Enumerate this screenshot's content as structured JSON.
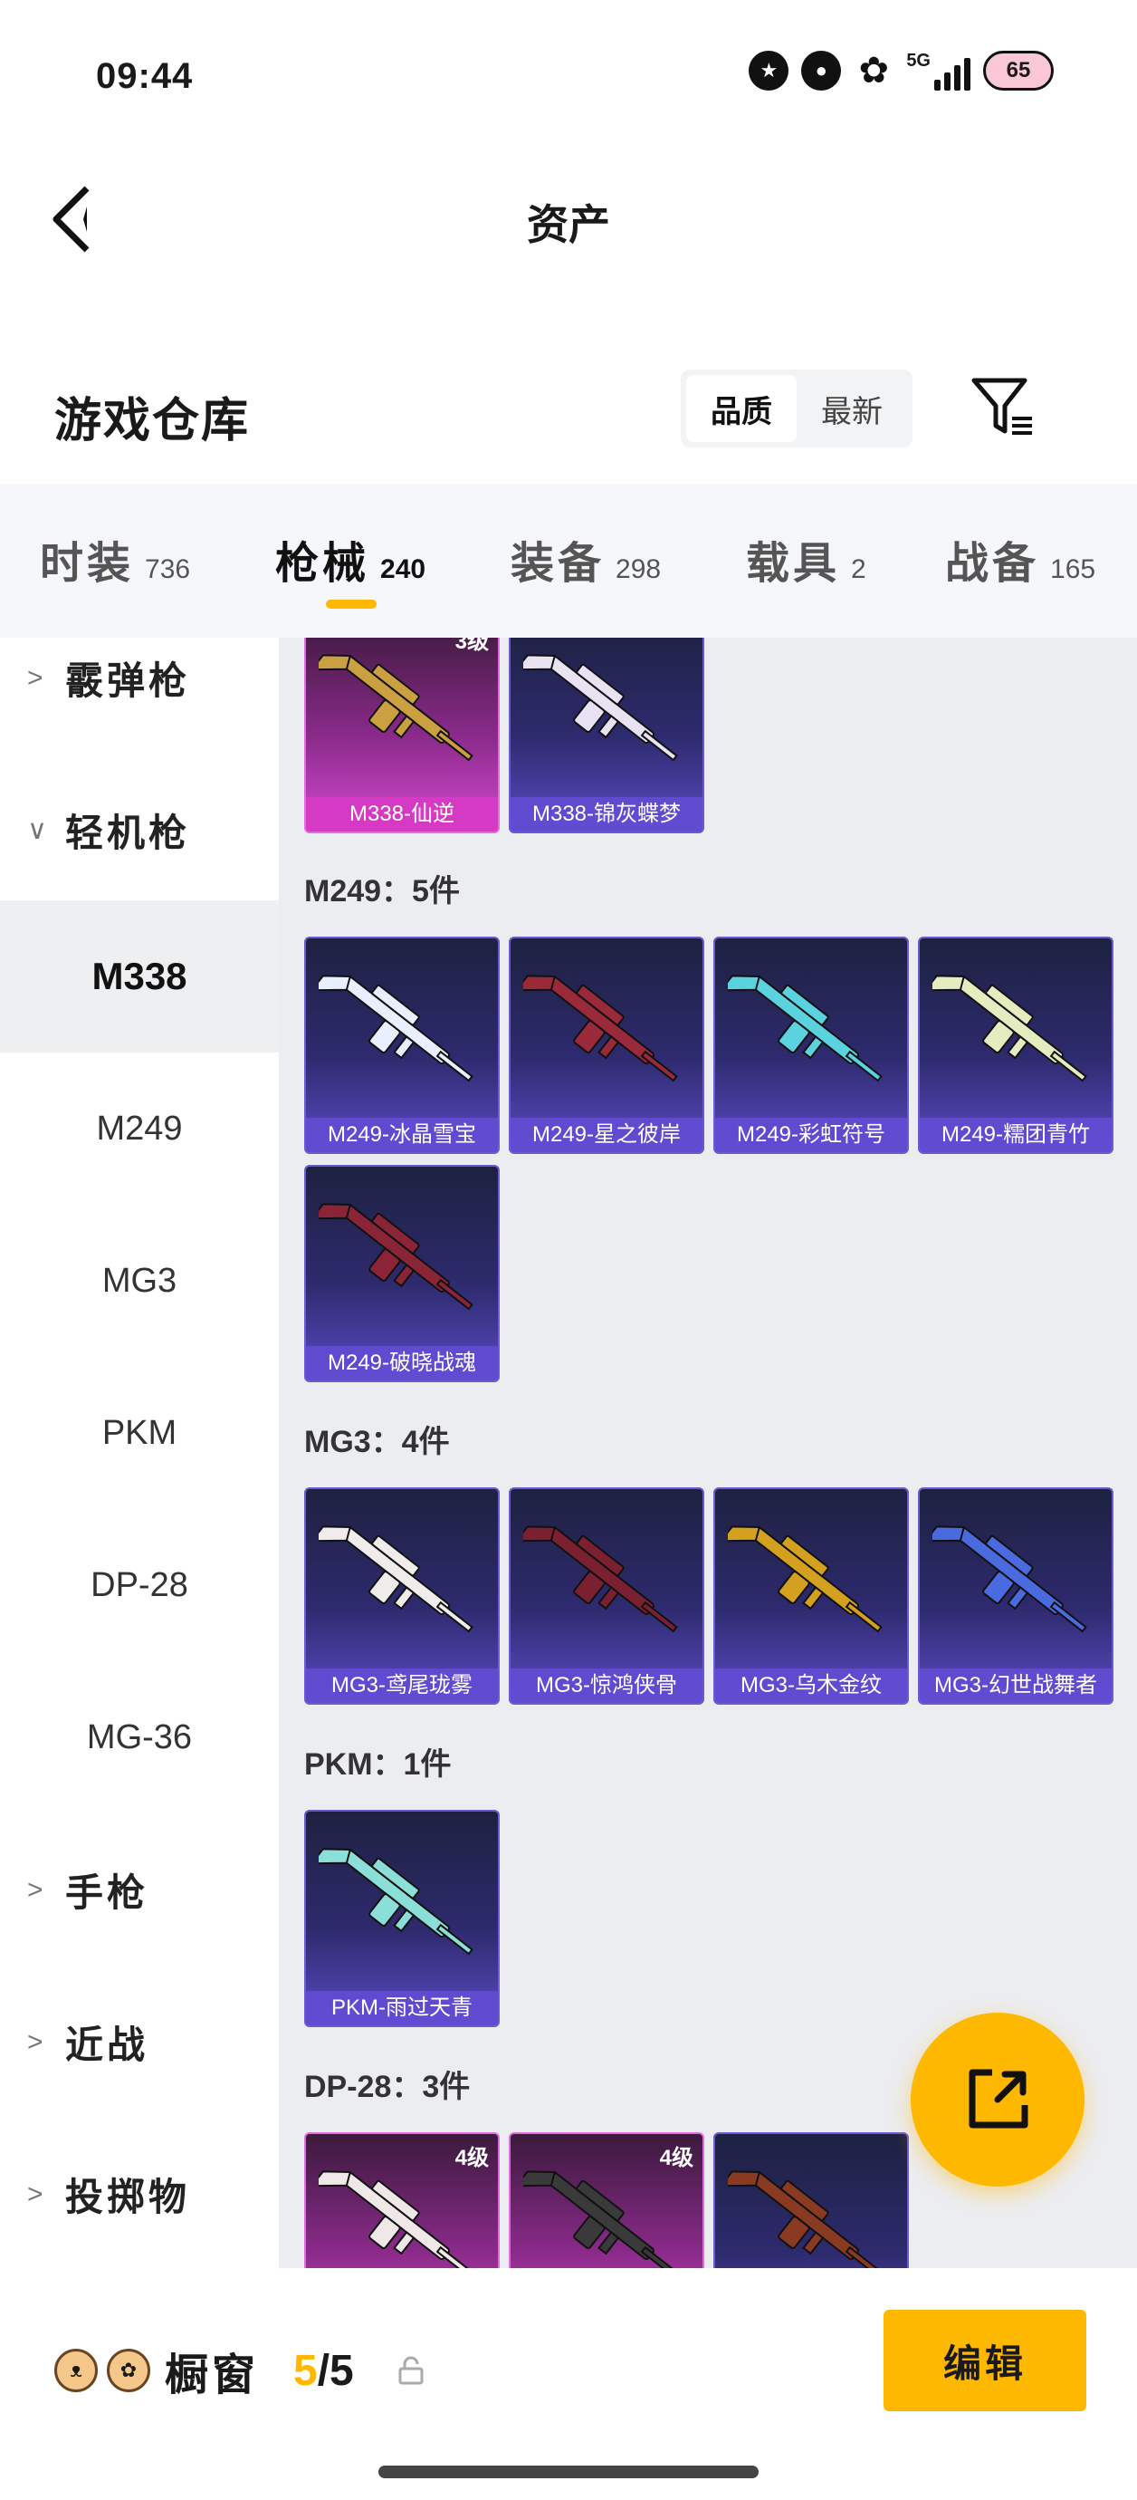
{
  "status": {
    "time": "09:44",
    "network": "5G",
    "battery": "65"
  },
  "header": {
    "title": "资产"
  },
  "section": {
    "title": "游戏仓库",
    "sort_options": [
      "品质",
      "最新"
    ],
    "sort_selected": "品质"
  },
  "tabs": [
    {
      "label": "时装",
      "count": "736"
    },
    {
      "label": "枪械",
      "count": "240"
    },
    {
      "label": "装备",
      "count": "298"
    },
    {
      "label": "载具",
      "count": "2"
    },
    {
      "label": "战备",
      "count": "165"
    }
  ],
  "active_tab": "枪械",
  "sidebar": {
    "groups": [
      {
        "label": "霰弹枪",
        "expanded": false
      },
      {
        "label": "轻机枪",
        "expanded": true
      },
      {
        "label": "手枪",
        "expanded": false
      },
      {
        "label": "近战",
        "expanded": false
      },
      {
        "label": "投掷物",
        "expanded": false
      }
    ],
    "subitems": [
      "M338",
      "M249",
      "MG3",
      "PKM",
      "DP-28",
      "MG-36"
    ],
    "selected": "M338"
  },
  "groups": {
    "m338": {
      "items": [
        {
          "name": "M338-仙逆",
          "level": "3级",
          "rarity": "gold",
          "color": "#caa040"
        },
        {
          "name": "M338-锦灰蝶梦",
          "level": "",
          "rarity": "purple",
          "color": "#e8e2f2"
        }
      ]
    },
    "m249": {
      "label": "M249：5件",
      "items": [
        {
          "name": "M249-冰晶雪宝",
          "rarity": "purple",
          "color": "#e8f0ff"
        },
        {
          "name": "M249-星之彼岸",
          "rarity": "purple",
          "color": "#9a2a3a"
        },
        {
          "name": "M249-彩虹符号",
          "rarity": "purple",
          "color": "#5ad2e0"
        },
        {
          "name": "M249-糯团青竹",
          "rarity": "purple",
          "color": "#e4ecc0"
        },
        {
          "name": "M249-破晓战魂",
          "rarity": "purple",
          "color": "#8a2436"
        }
      ]
    },
    "mg3": {
      "label": "MG3：4件",
      "items": [
        {
          "name": "MG3-鸢尾珑雾",
          "rarity": "purple",
          "color": "#f0ecec"
        },
        {
          "name": "MG3-惊鸿侠骨",
          "rarity": "purple",
          "color": "#7a2030"
        },
        {
          "name": "MG3-乌木金纹",
          "rarity": "purple",
          "color": "#d4a020"
        },
        {
          "name": "MG3-幻世战舞者",
          "rarity": "purple",
          "color": "#4a6ae0"
        }
      ]
    },
    "pkm": {
      "label": "PKM：1件",
      "items": [
        {
          "name": "PKM-雨过天青",
          "rarity": "purple",
          "color": "#8ae0d8"
        }
      ]
    },
    "dp28": {
      "label": "DP-28：3件",
      "items": [
        {
          "name": "",
          "level": "4级",
          "rarity": "gold",
          "color": "#f0e8e8"
        },
        {
          "name": "",
          "level": "4级",
          "rarity": "gold",
          "color": "#3a3a3a"
        },
        {
          "name": "",
          "level": "",
          "rarity": "purple",
          "color": "#8a3a20"
        }
      ]
    }
  },
  "bottom": {
    "label": "橱窗",
    "count_current": "5",
    "count_total": "/5",
    "edit_label": "编辑"
  }
}
